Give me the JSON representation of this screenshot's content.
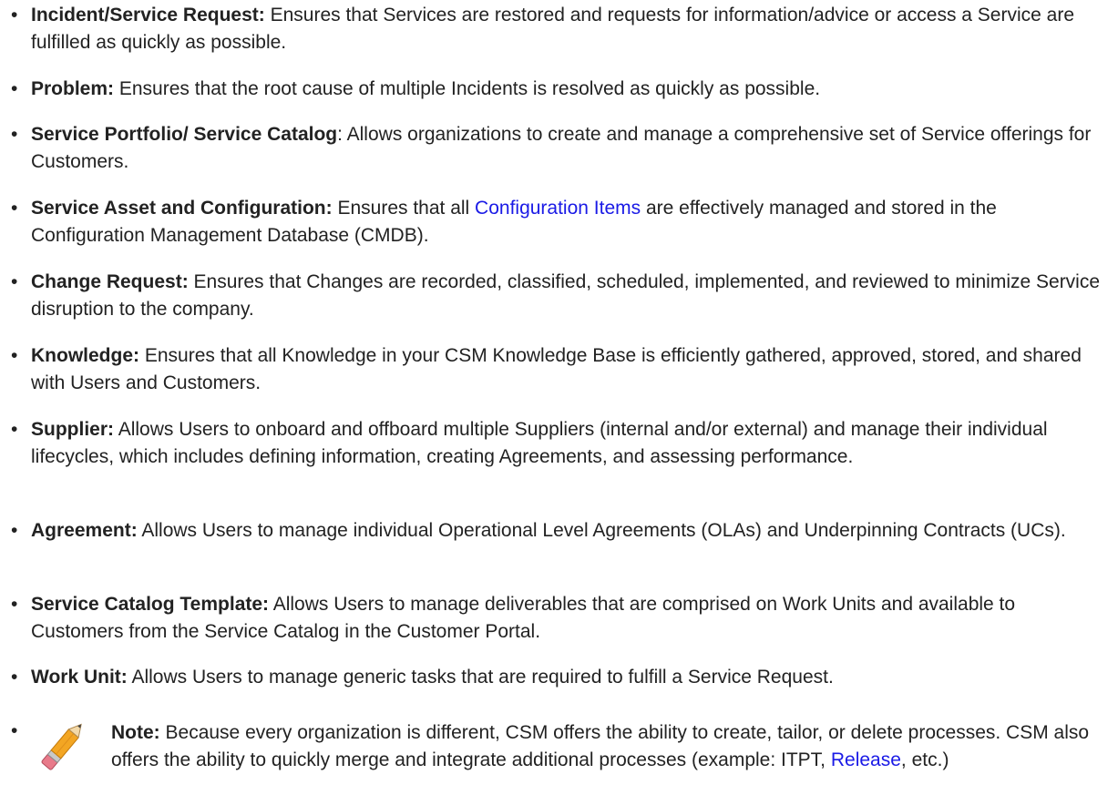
{
  "items": [
    {
      "term": "Incident/Service Request:",
      "desc": " Ensures that Services are restored and requests for information/advice or access a Service are fulfilled as quickly as possible."
    },
    {
      "term": "Problem:",
      "desc": " Ensures that the root cause of multiple Incidents is resolved as quickly as possible."
    },
    {
      "term": "Service Portfolio/ Service Catalog",
      "desc": ": Allows organizations to create and manage a comprehensive set of Service offerings for Customers."
    },
    {
      "term": "Service Asset and Configuration:",
      "desc_before": " Ensures that all ",
      "link": "Configuration Items",
      "desc_after": " are effectively managed and stored in the Configuration Management Database (CMDB)."
    },
    {
      "term": "Change Request:",
      "desc": " Ensures that Changes are recorded, classified, scheduled, implemented, and reviewed to minimize Service disruption to the company."
    },
    {
      "term": "Knowledge:",
      "desc": " Ensures that all Knowledge in your CSM Knowledge Base is efficiently gathered, approved, stored, and shared with Users and Customers."
    },
    {
      "term": "Supplier:",
      "desc": " Allows Users to onboard and offboard multiple Suppliers (internal and/or external) and manage their individual lifecycles, which includes defining information, creating Agreements, and assessing performance."
    },
    {
      "term": "Agreement:",
      "desc": " Allows Users to manage individual Operational Level Agreements (OLAs) and Underpinning Contracts (UCs)."
    },
    {
      "term": "Service Catalog Template:",
      "desc": " Allows Users to manage deliverables that are comprised on Work Units and available to Customers from the Service Catalog in the Customer Portal."
    },
    {
      "term": "Work Unit:",
      "desc": " Allows Users to manage generic tasks that are required to fulfill a Service Request."
    }
  ],
  "note": {
    "term": "Note:",
    "desc_before": " Because every organization is different, CSM offers the ability to create, tailor, or delete processes. CSM also offers the ability to quickly merge and integrate additional processes (example: ITPT, ",
    "link": "Release",
    "desc_after": ", etc.)",
    "icon": "pencil-icon"
  },
  "bullet_char": "•",
  "colors": {
    "text": "#222222",
    "link": "#1a1ae6"
  }
}
